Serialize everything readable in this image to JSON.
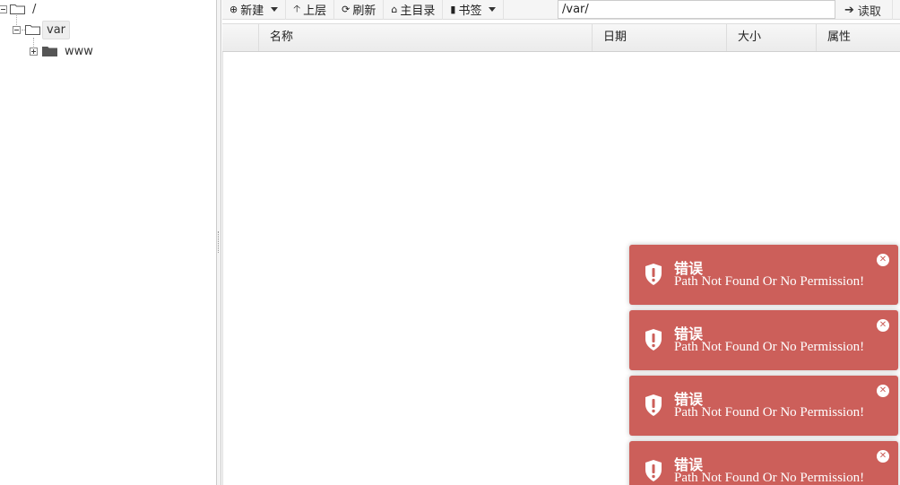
{
  "tree": {
    "root_label": "/",
    "var_label": "var",
    "www_label": "www"
  },
  "toolbar": {
    "new_label": "新建",
    "up_label": "上层",
    "refresh_label": "刷新",
    "home_label": "主目录",
    "bookmark_label": "书签",
    "path_value": "/var/",
    "read_label": "读取"
  },
  "columns": {
    "name": "名称",
    "date": "日期",
    "size": "大小",
    "attr": "属性"
  },
  "toasts": [
    {
      "title": "错误",
      "message": "Path Not Found Or No Permission!"
    },
    {
      "title": "错误",
      "message": "Path Not Found Or No Permission!"
    },
    {
      "title": "错误",
      "message": "Path Not Found Or No Permission!"
    },
    {
      "title": "错误",
      "message": "Path Not Found Or No Permission!"
    }
  ],
  "colors": {
    "toast_bg": "#cc5f5a",
    "toolbar_bg": "#f5f5f5"
  }
}
